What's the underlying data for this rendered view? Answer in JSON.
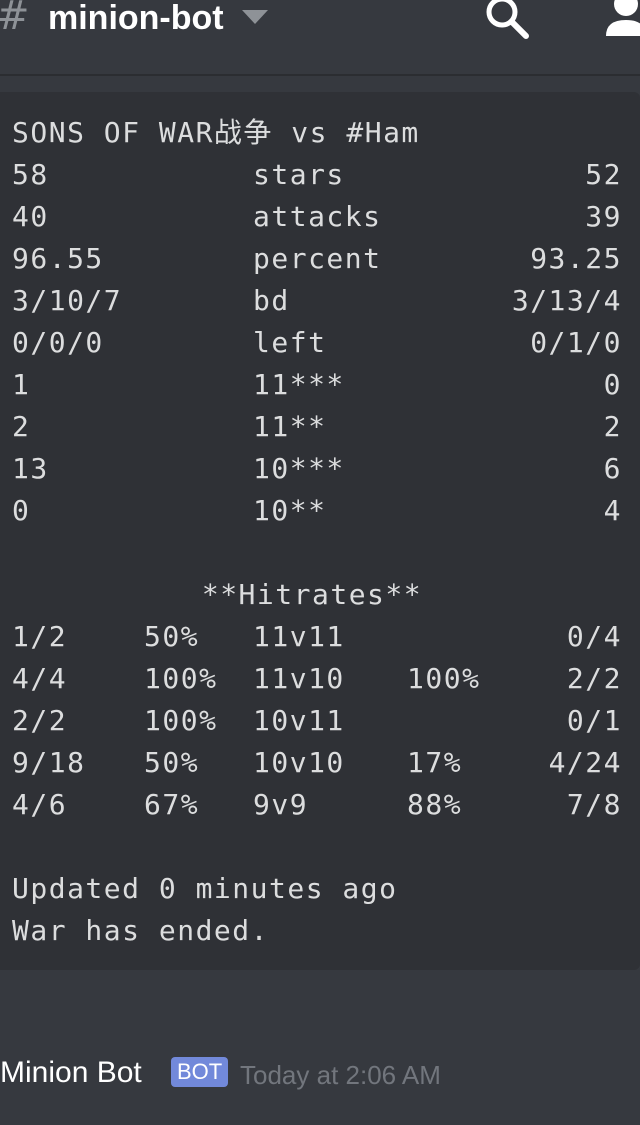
{
  "header": {
    "channel_name": "minion-bot",
    "hash_glyph": "#",
    "icons": [
      "hash-icon",
      "chevron-down-icon",
      "search-icon",
      "member-list-icon"
    ]
  },
  "embed": {
    "title": "SONS OF WAR战争 vs #Ham",
    "stats": [
      {
        "left": "58",
        "label": "stars",
        "right": "52"
      },
      {
        "left": "40",
        "label": "attacks",
        "right": "39"
      },
      {
        "left": "96.55",
        "label": "percent",
        "right": "93.25"
      },
      {
        "left": "3/10/7",
        "label": "bd",
        "right": "3/13/4"
      },
      {
        "left": "0/0/0",
        "label": "left",
        "right": "0/1/0"
      },
      {
        "left": "1",
        "label": "11***",
        "right": "0"
      },
      {
        "left": "2",
        "label": "11**",
        "right": "2"
      },
      {
        "left": "13",
        "label": "10***",
        "right": "6"
      },
      {
        "left": "0",
        "label": "10**",
        "right": "4"
      }
    ],
    "hitrates_title": "**Hitrates**",
    "hitrates": [
      {
        "left_ratio": "1/2",
        "left_pct": "50%",
        "matchup": "11v11",
        "right_pct": "",
        "right_ratio": "0/4"
      },
      {
        "left_ratio": "4/4",
        "left_pct": "100%",
        "matchup": "11v10",
        "right_pct": "100%",
        "right_ratio": "2/2"
      },
      {
        "left_ratio": "2/2",
        "left_pct": "100%",
        "matchup": "10v11",
        "right_pct": "",
        "right_ratio": "0/1"
      },
      {
        "left_ratio": "9/18",
        "left_pct": "50%",
        "matchup": "10v10",
        "right_pct": "17%",
        "right_ratio": "4/24"
      },
      {
        "left_ratio": "4/6",
        "left_pct": "67%",
        "matchup": "9v9",
        "right_pct": "88%",
        "right_ratio": "7/8"
      }
    ],
    "footer_lines": [
      "Updated 0 minutes ago",
      "War has ended."
    ]
  },
  "message": {
    "author": "Minion Bot",
    "badge": "BOT",
    "timestamp": "Today at 2:06 AM"
  },
  "colors": {
    "background": "#36393f",
    "embed_background": "#2f3136",
    "text": "#dcddde",
    "muted": "#72767d",
    "bot_badge": "#7289da"
  }
}
